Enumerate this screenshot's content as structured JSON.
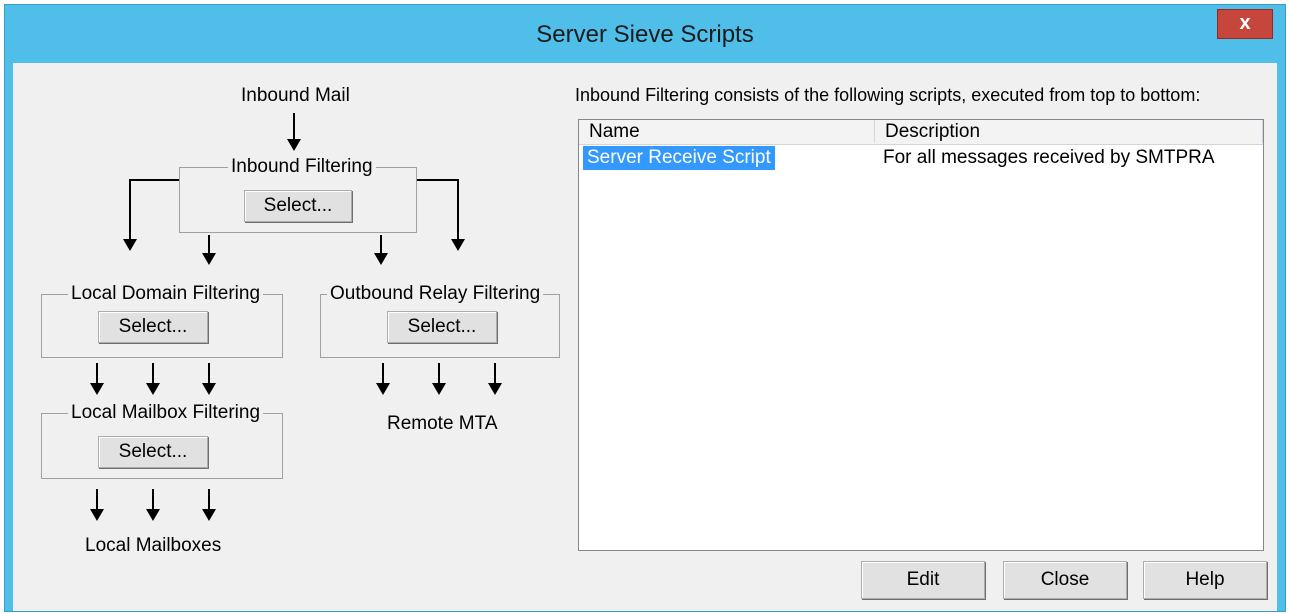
{
  "window": {
    "title": "Server Sieve Scripts",
    "close_label": "x"
  },
  "flow": {
    "inbound_mail": "Inbound Mail",
    "inbound_filtering": {
      "title": "Inbound Filtering",
      "button": "Select..."
    },
    "local_domain_filtering": {
      "title": "Local Domain Filtering",
      "button": "Select..."
    },
    "outbound_relay_filtering": {
      "title": "Outbound Relay Filtering",
      "button": "Select..."
    },
    "local_mailbox_filtering": {
      "title": "Local Mailbox Filtering",
      "button": "Select..."
    },
    "remote_mta": "Remote MTA",
    "local_mailboxes": "Local Mailboxes"
  },
  "scripts": {
    "heading": "Inbound Filtering consists of the following scripts, executed from top to bottom:",
    "columns": [
      "Name",
      "Description"
    ],
    "rows": [
      {
        "name": "Server Receive Script",
        "description": "For all messages received by SMTPRA",
        "selected": true
      }
    ]
  },
  "buttons": {
    "edit": "Edit",
    "close": "Close",
    "help": "Help"
  },
  "colors": {
    "titlebar": "#4fbfe9",
    "close_button": "#c7463b",
    "selection": "#3399ff"
  }
}
